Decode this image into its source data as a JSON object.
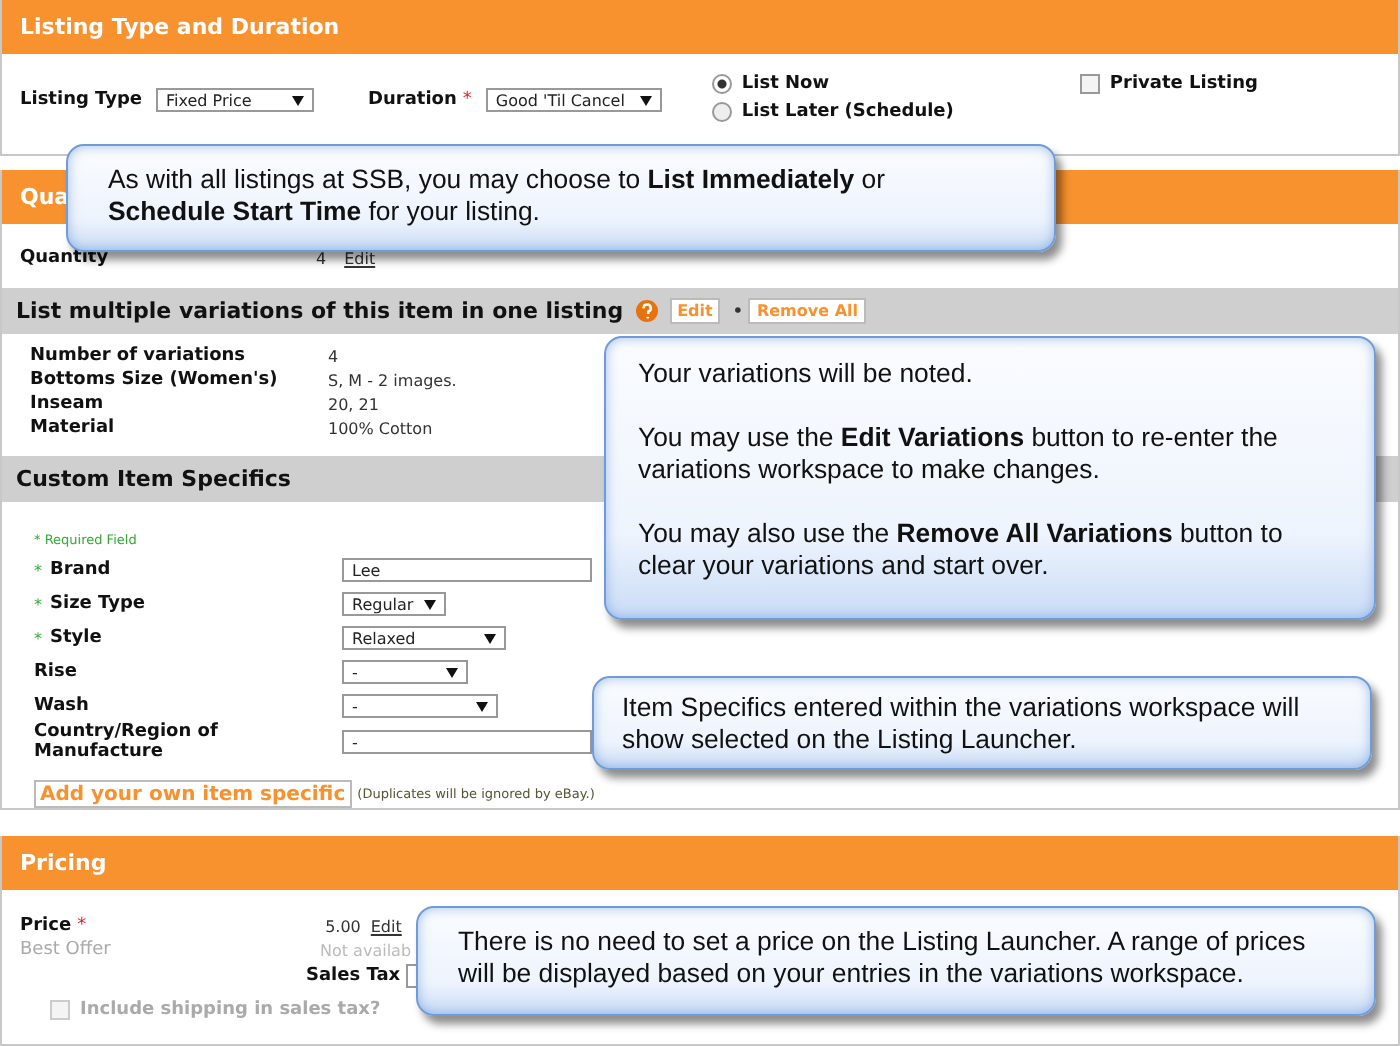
{
  "listing_section": {
    "title": "Listing Type and Duration",
    "listing_type": {
      "label": "Listing Type",
      "value": "Fixed Price"
    },
    "duration": {
      "label": "Duration",
      "marker": "*",
      "value": "Good 'Til Cancel"
    },
    "start_options": [
      {
        "label": "List Now",
        "selected": true
      },
      {
        "label": "List Later (Schedule)",
        "selected": false
      }
    ],
    "private_listing": {
      "label": "Private Listing",
      "checked": false
    }
  },
  "quantity_section": {
    "title": "Qua",
    "quantity": {
      "label": "Quantity",
      "value": "4",
      "link": "Edit"
    },
    "variations": {
      "title": "List multiple variations of this item in one listing",
      "buttons": [
        "Edit",
        "Remove All"
      ],
      "separator": "•",
      "rows": [
        {
          "label": "Number of variations",
          "value": "4"
        },
        {
          "label": "Bottoms Size (Women's)",
          "value": "S, M - 2 images."
        },
        {
          "label": "Inseam",
          "value": "20, 21"
        },
        {
          "label": "Material",
          "value": "100% Cotton"
        }
      ]
    },
    "item_specifics": {
      "title": "Custom Item Specifics",
      "required_note": "* Required Field",
      "fields": [
        {
          "label": "Brand",
          "marker": "*",
          "kind": "text",
          "value": "Lee"
        },
        {
          "label": "Size Type",
          "marker": "*",
          "kind": "select",
          "value": "Regular"
        },
        {
          "label": "Style",
          "marker": "*",
          "kind": "select",
          "value": "Relaxed"
        },
        {
          "label": "Rise",
          "kind": "select",
          "value": "-"
        },
        {
          "label": "Wash",
          "kind": "select",
          "value": "-"
        },
        {
          "label": "Country/Region of Manufacture",
          "kind": "text",
          "value": "-"
        }
      ],
      "add_button": "Add your own item specific",
      "add_note": "(Duplicates will be ignored by eBay.)"
    }
  },
  "pricing": {
    "title": "Pricing",
    "price": {
      "label": "Price",
      "marker": "*",
      "value": "5.00",
      "link": "Edit"
    },
    "best_offer": {
      "label": "Best Offer",
      "value": "Not availab",
      "disabled": true
    },
    "sales_tax": {
      "label": "Sales Tax"
    },
    "include_shipping": {
      "label": "Include shipping in sales tax?",
      "checked": false,
      "disabled": true
    }
  },
  "callouts": [
    {
      "paragraphs": [
        "As with all listings at SSB, you may choose to **List Immediately** or **Schedule Start Time** for your listing."
      ]
    },
    {
      "paragraphs": [
        "Your variations will be noted.",
        "You may use the **Edit Variations** button to re-enter the variations workspace to make changes.",
        "You may also use the **Remove All Variations** button to clear your variations and start over."
      ]
    },
    {
      "paragraphs": [
        "Item Specifics entered within the variations workspace will show selected on the Listing Launcher."
      ]
    },
    {
      "paragraphs": [
        "There is no need to set a price on the Listing Launcher. A range of prices will be displayed based on your entries in the variations workspace."
      ]
    }
  ]
}
